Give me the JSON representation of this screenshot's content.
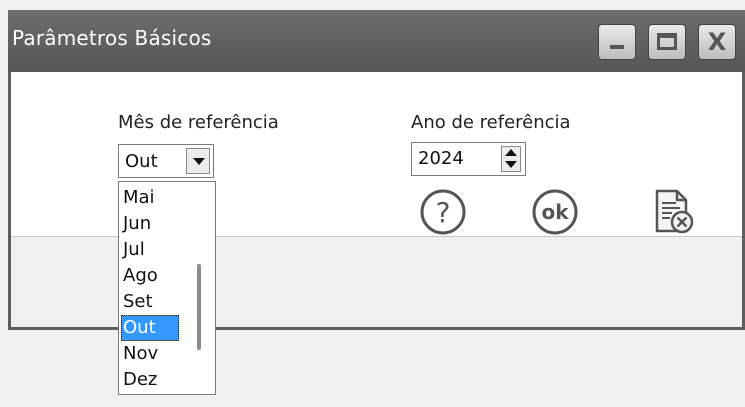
{
  "window": {
    "title": "Parâmetros Básicos",
    "controls": {
      "minimize": "minimize-icon",
      "maximize": "maximize-icon",
      "close": "close-icon"
    },
    "close_glyph": "X"
  },
  "form": {
    "month": {
      "label": "Mês de referência",
      "selected": "Out"
    },
    "year": {
      "label": "Ano de referência",
      "value": "2024"
    }
  },
  "month_dropdown": {
    "visible_options": [
      "Mai",
      "Jun",
      "Jul",
      "Ago",
      "Set",
      "Out",
      "Nov",
      "Dez"
    ],
    "selected_index": 5
  },
  "footer": {
    "buttons": [
      {
        "name": "help-button",
        "icon": "question-mark-icon",
        "glyph": "?"
      },
      {
        "name": "ok-button",
        "icon": "ok-icon",
        "glyph": "ok"
      },
      {
        "name": "cancel-button",
        "icon": "document-cancel-icon"
      }
    ]
  },
  "colors": {
    "titlebar": "#5e5e5e",
    "selection": "#3399ff",
    "icon_gray": "#555555"
  }
}
